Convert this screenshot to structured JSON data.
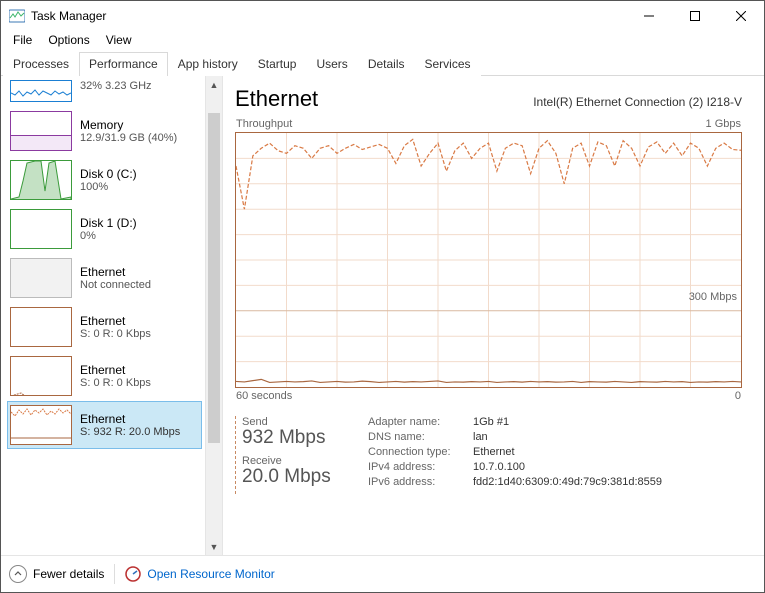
{
  "window": {
    "title": "Task Manager"
  },
  "menu": {
    "file": "File",
    "options": "Options",
    "view": "View"
  },
  "tabs": {
    "processes": "Processes",
    "performance": "Performance",
    "app_history": "App history",
    "startup": "Startup",
    "users": "Users",
    "details": "Details",
    "services": "Services"
  },
  "sidebar": {
    "cpu_sub": "32% 3.23 GHz",
    "memory": {
      "label": "Memory",
      "sub": "12.9/31.9 GB (40%)"
    },
    "disk0": {
      "label": "Disk 0 (C:)",
      "sub": "100%"
    },
    "disk1": {
      "label": "Disk 1 (D:)",
      "sub": "0%"
    },
    "eth_disabled": {
      "label": "Ethernet",
      "sub": "Not connected"
    },
    "eth1": {
      "label": "Ethernet",
      "sub": "S: 0 R: 0 Kbps"
    },
    "eth2": {
      "label": "Ethernet",
      "sub": "S: 0 R: 0 Kbps"
    },
    "eth3": {
      "label": "Ethernet",
      "sub": "S: 932 R: 20.0 Mbps"
    }
  },
  "pane": {
    "title": "Ethernet",
    "subtitle": "Intel(R) Ethernet Connection (2) I218-V",
    "chart_label_left": "Throughput",
    "chart_label_right": "1 Gbps",
    "chart_bottom_left": "60 seconds",
    "chart_bottom_right": "0",
    "threshold_label": "300 Mbps"
  },
  "stats": {
    "send_label": "Send",
    "send_value": "932 Mbps",
    "receive_label": "Receive",
    "receive_value": "20.0 Mbps",
    "adapter_k": "Adapter name:",
    "adapter_v": "1Gb #1",
    "dns_k": "DNS name:",
    "dns_v": "lan",
    "conn_k": "Connection type:",
    "conn_v": "Ethernet",
    "ipv4_k": "IPv4 address:",
    "ipv4_v": "10.7.0.100",
    "ipv6_k": "IPv6 address:",
    "ipv6_v": "fdd2:1d40:6309:0:49d:79c9:381d:8559"
  },
  "footer": {
    "fewer_details": "Fewer details",
    "resource_monitor": "Open Resource Monitor"
  },
  "chart_data": {
    "type": "line",
    "title": "Throughput",
    "xlabel": "60 seconds → 0",
    "ylabel": "Throughput",
    "ylim": [
      0,
      1000
    ],
    "threshold": 300,
    "x_seconds": [
      60,
      59,
      58,
      57,
      56,
      55,
      54,
      53,
      52,
      51,
      50,
      49,
      48,
      47,
      46,
      45,
      44,
      43,
      42,
      41,
      40,
      39,
      38,
      37,
      36,
      35,
      34,
      33,
      32,
      31,
      30,
      29,
      28,
      27,
      26,
      25,
      24,
      23,
      22,
      21,
      20,
      19,
      18,
      17,
      16,
      15,
      14,
      13,
      12,
      11,
      10,
      9,
      8,
      7,
      6,
      5,
      4,
      3,
      2,
      1,
      0
    ],
    "series": [
      {
        "name": "Send (Mbps)",
        "color": "#d97a45",
        "values": [
          870,
          700,
          910,
          940,
          960,
          930,
          920,
          950,
          940,
          900,
          940,
          950,
          920,
          940,
          955,
          935,
          945,
          955,
          940,
          880,
          950,
          975,
          870,
          920,
          960,
          850,
          930,
          960,
          900,
          940,
          960,
          850,
          940,
          960,
          950,
          840,
          940,
          970,
          920,
          800,
          940,
          960,
          870,
          965,
          950,
          870,
          970,
          940,
          870,
          945,
          965,
          920,
          960,
          910,
          960,
          940,
          870,
          940,
          960,
          935,
          932
        ]
      },
      {
        "name": "Receive (Mbps)",
        "color": "#a96740",
        "values": [
          22,
          20,
          25,
          30,
          18,
          20,
          22,
          20,
          21,
          24,
          18,
          20,
          22,
          19,
          20,
          23,
          21,
          18,
          20,
          22,
          19,
          21,
          20,
          22,
          24,
          18,
          20,
          19,
          21,
          20,
          22,
          18,
          20,
          21,
          19,
          22,
          20,
          21,
          19,
          20,
          22,
          18,
          21,
          20,
          19,
          22,
          20,
          18,
          21,
          20,
          19,
          22,
          20,
          21,
          18,
          20,
          19,
          21,
          20,
          22,
          20
        ]
      }
    ]
  }
}
